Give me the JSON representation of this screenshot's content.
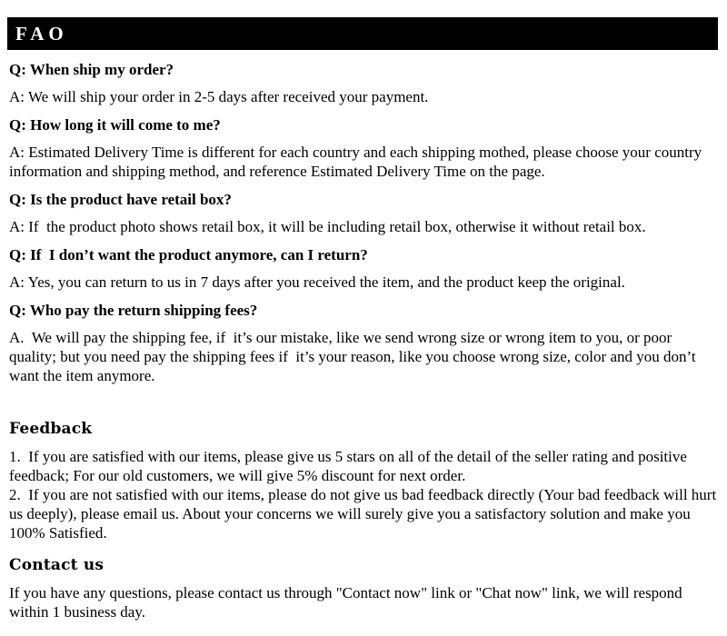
{
  "header": {
    "title": "FAO"
  },
  "faq": {
    "items": [
      {
        "question": "Q: When ship my order?",
        "answer": "A: We will ship your order in 2-5 days after received your payment."
      },
      {
        "question": "Q: How long it will come to me?",
        "answer": "A: Estimated Delivery Time is different for each country and each shipping mothed, please choose your country information and shipping method, and reference Estimated Delivery Time on the page."
      },
      {
        "question": "Q: Is the product have retail box?",
        "answer": "A: If  the product photo shows retail box, it will be including retail box, otherwise it without retail box."
      },
      {
        "question": "Q: If  I don’t want the product anymore, can I return?",
        "answer": "A: Yes, you can return to us in 7 days after you received the item, and the product keep the original."
      },
      {
        "question": "Q: Who pay the return shipping fees?",
        "answer": "A.  We will pay the shipping fee, if  it’s our mistake, like we send wrong size or wrong item to you, or poor quality; but you need pay the shipping fees if  it’s your reason, like you choose wrong size, color and you don’t want the item anymore."
      }
    ]
  },
  "feedback": {
    "heading": "Feedback",
    "body": "1.  If you are satisfied with our items, please give us 5 stars on all of the detail of the seller rating and positive feedback; For our old customers, we will give 5% discount for next order.\n2.  If you are not satisfied with our items, please do not give us bad feedback directly (Your bad feedback will hurt us deeply), please email us. About your concerns we will surely give you a satisfactory solution and make you 100% Satisfied."
  },
  "contact": {
    "heading": "Contact us",
    "body": "If you have any questions, please contact us through \"Contact now\" link or \"Chat now\" link, we will respond within 1 business day."
  },
  "colors": {
    "header_background": "#000000",
    "header_text": "#ffffff",
    "page_background": "#ffffff",
    "body_text": "#000000"
  }
}
